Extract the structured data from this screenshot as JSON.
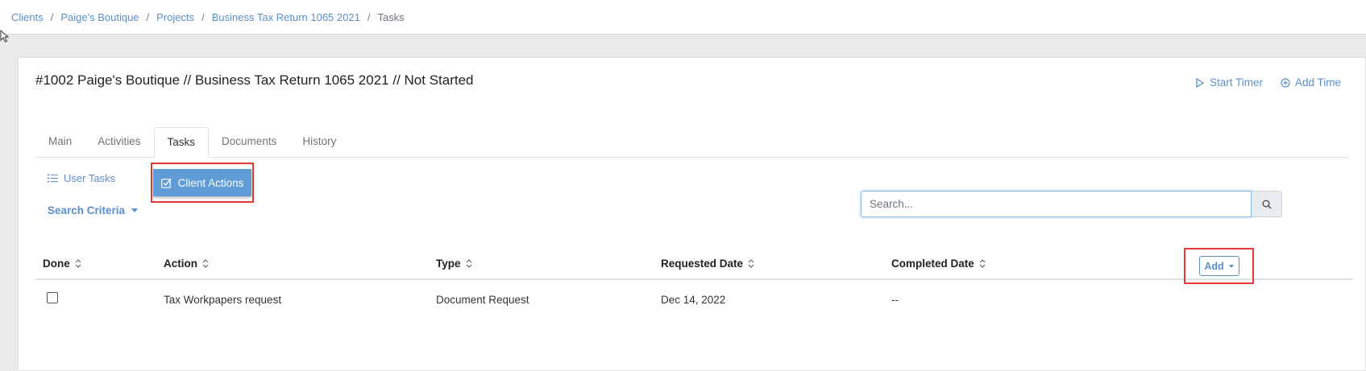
{
  "breadcrumb": {
    "items": [
      "Clients",
      "Paige's Boutique",
      "Projects",
      "Business Tax Return 1065 2021"
    ],
    "current": "Tasks",
    "separator": "/"
  },
  "project": {
    "title": "#1002 Paige's Boutique // Business Tax Return 1065 2021 // Not Started"
  },
  "actions": {
    "start_timer": "Start Timer",
    "add_time": "Add Time"
  },
  "tabs": [
    {
      "label": "Main"
    },
    {
      "label": "Activities"
    },
    {
      "label": "Tasks",
      "active": true
    },
    {
      "label": "Documents"
    },
    {
      "label": "History"
    }
  ],
  "subtabs": {
    "user_tasks": "User Tasks",
    "client_actions": "Client Actions"
  },
  "search_criteria": "Search Criteria",
  "search": {
    "placeholder": "Search...",
    "value": ""
  },
  "table": {
    "columns": [
      "Done",
      "Action",
      "Type",
      "Requested Date",
      "Completed Date"
    ],
    "add_label": "Add",
    "rows": [
      {
        "done": false,
        "action": "Tax Workpapers request",
        "type": "Document Request",
        "requested": "Dec 14, 2022",
        "completed": "--"
      }
    ]
  },
  "colors": {
    "accent": "#5b8fc9",
    "primary_button": "#5f9bd4",
    "highlight": "#e53935"
  }
}
